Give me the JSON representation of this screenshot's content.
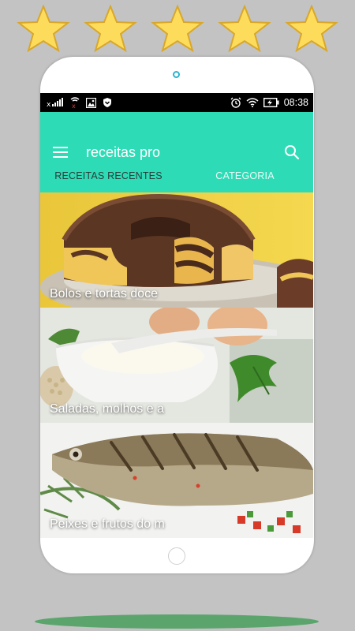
{
  "rating": {
    "stars": 5,
    "star_color": "#fddc5c",
    "star_stroke": "#d8a72a"
  },
  "status_bar": {
    "time": "08:38",
    "icons": [
      "signal-off-icon",
      "wifi-icon",
      "image-icon",
      "shield-icon",
      "alarm-icon",
      "battery-charging-icon"
    ]
  },
  "app_bar": {
    "title": "receitas pro",
    "color": "#2ddcb6"
  },
  "tabs": [
    {
      "label": "RECEITAS RECENTES",
      "active": true
    },
    {
      "label": "CATEGORIA",
      "active": false
    }
  ],
  "cards": [
    {
      "label": "Bolos e tortas doce",
      "image": "marble-bundt-cake"
    },
    {
      "label": "Saladas, molhos e a",
      "image": "cream-sauce-bowl"
    },
    {
      "label": "Peixes e frutos do m",
      "image": "grilled-fish"
    }
  ]
}
